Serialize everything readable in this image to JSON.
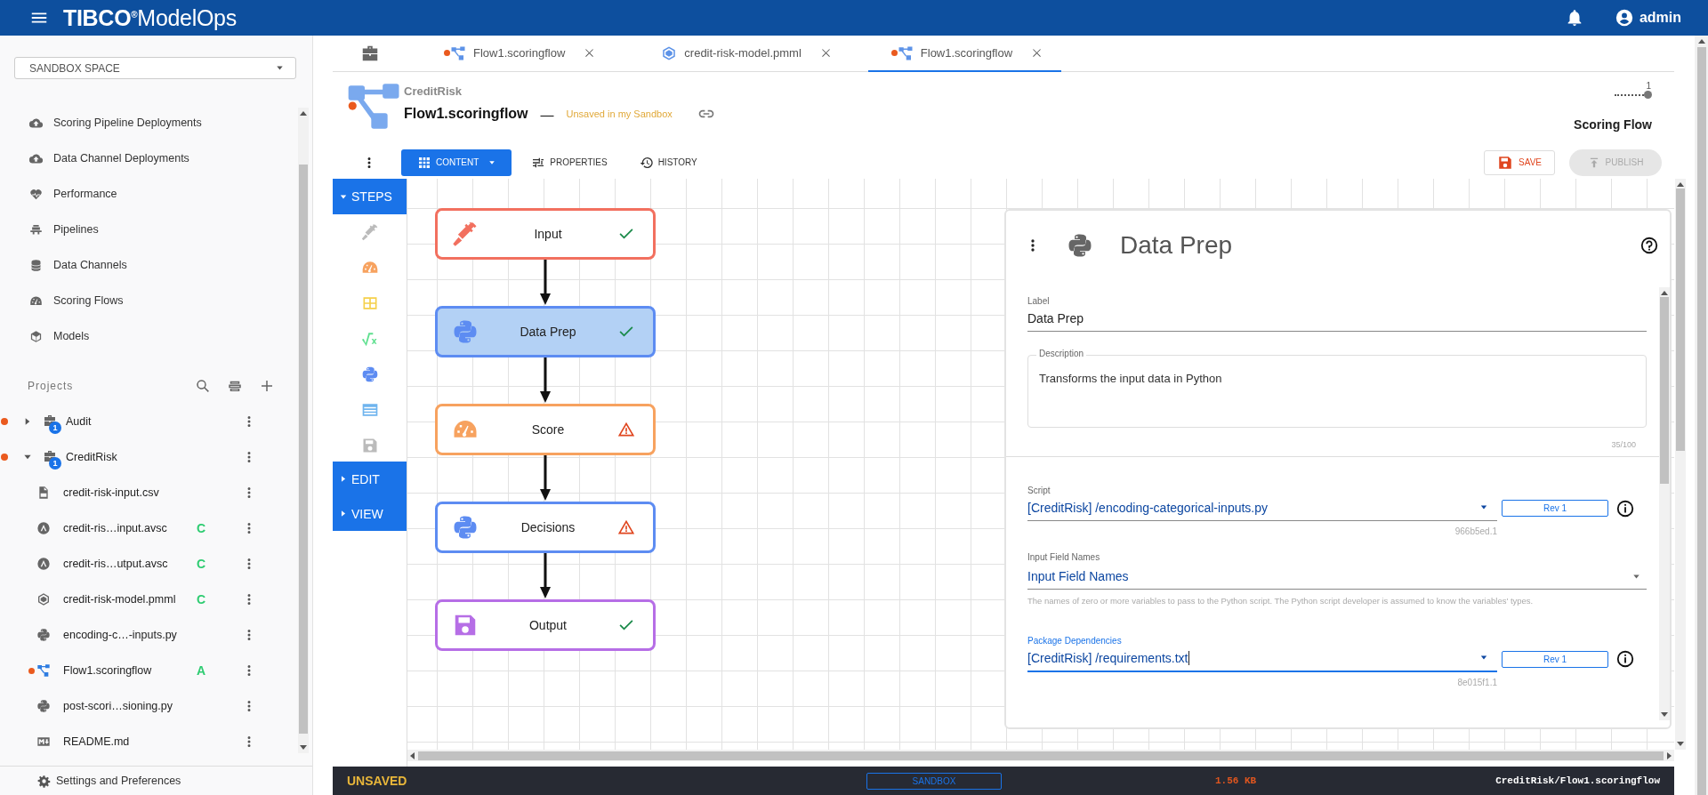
{
  "header": {
    "logo": {
      "brand": "TIBCO$^{®}$",
      "product": "ModelOps"
    },
    "user": "admin"
  },
  "sidebar": {
    "space": "SANDBOX SPACE",
    "nav": [
      {
        "label": "Scoring Pipeline Deployments",
        "kind": "cloud"
      },
      {
        "label": "Data Channel Deployments",
        "kind": "cloud"
      },
      {
        "label": "Performance",
        "kind": "heart"
      },
      {
        "label": "Pipelines",
        "kind": "pipeline"
      },
      {
        "label": "Data Channels",
        "kind": "database"
      },
      {
        "label": "Scoring Flows",
        "kind": "gauge"
      },
      {
        "label": "Models",
        "kind": "cube"
      }
    ],
    "projects_title": "Projects",
    "projects": [
      {
        "name": "Audit",
        "badge": "1",
        "unsaved": true,
        "expanded": false
      },
      {
        "name": "CreditRisk",
        "badge": "1",
        "unsaved": true,
        "expanded": true,
        "children": [
          {
            "name": "credit-risk-input.csv",
            "kind": "csv",
            "unsaved": false
          },
          {
            "name": "credit-ris…input.avsc",
            "kind": "avro",
            "status": "C",
            "unsaved": false
          },
          {
            "name": "credit-ris…utput.avsc",
            "kind": "avro",
            "status": "C",
            "unsaved": false
          },
          {
            "name": "credit-risk-model.pmml",
            "kind": "pmml",
            "status": "C",
            "unsaved": false
          },
          {
            "name": "encoding-c…-inputs.py",
            "kind": "python",
            "unsaved": false
          },
          {
            "name": "Flow1.scoringflow",
            "kind": "flow",
            "status": "A",
            "unsaved": true
          },
          {
            "name": "post-scori…sioning.py",
            "kind": "python",
            "unsaved": false
          },
          {
            "name": "README.md",
            "kind": "markdown",
            "unsaved": false
          }
        ]
      }
    ],
    "settings": "Settings and Preferences"
  },
  "tabs": [
    {
      "label": "Flow1.scoringflow",
      "kind": "flow",
      "unsaved": true,
      "selected": false
    },
    {
      "label": "credit-risk-model.pmml",
      "kind": "pmml",
      "unsaved": false,
      "selected": false
    },
    {
      "label": "Flow1.scoringflow",
      "kind": "flow",
      "unsaved": true,
      "selected": true
    }
  ],
  "document": {
    "project": "CreditRisk",
    "name": "Flow1.scoringflow",
    "separator": "—",
    "status": "Unsaved in my Sandbox",
    "unsaved": true,
    "version": "1",
    "type": "Scoring Flow"
  },
  "toolbar": {
    "views": [
      {
        "label": "CONTENT",
        "selected": true
      },
      {
        "label": "PROPERTIES",
        "selected": false
      },
      {
        "label": "HISTORY",
        "selected": false
      }
    ],
    "save": "SAVE",
    "publish": {
      "label": "PUBLISH",
      "disabled": true
    }
  },
  "palette": {
    "sections": [
      {
        "label": "STEPS",
        "expanded": true
      },
      {
        "label": "EDIT",
        "expanded": false
      },
      {
        "label": "VIEW",
        "expanded": false
      }
    ],
    "items": [
      {
        "kind": "input",
        "disabled": true
      },
      {
        "kind": "gauge",
        "disabled": false
      },
      {
        "kind": "table",
        "disabled": false
      },
      {
        "kind": "sqrt",
        "disabled": false
      },
      {
        "kind": "python",
        "disabled": false
      },
      {
        "kind": "list",
        "disabled": false
      },
      {
        "kind": "save",
        "disabled": true
      }
    ]
  },
  "flow": {
    "nodes": [
      {
        "label": "Input",
        "kind": "input",
        "color": "#f2705f",
        "valid": true,
        "selected": false
      },
      {
        "label": "Data Prep",
        "kind": "python",
        "color": "#5d8cf2",
        "valid": true,
        "selected": true
      },
      {
        "label": "Score",
        "kind": "gauge",
        "color": "#f7a25f",
        "valid": false,
        "selected": false
      },
      {
        "label": "Decisions",
        "kind": "python",
        "color": "#5d8cf2",
        "valid": false,
        "selected": false
      },
      {
        "label": "Output",
        "kind": "save",
        "color": "#b66ee6",
        "valid": true,
        "selected": false
      }
    ]
  },
  "panel": {
    "title": "Data Prep",
    "label_field": {
      "label": "Label",
      "value": "Data Prep"
    },
    "description": {
      "label": "Description",
      "value": "Transforms the input data in Python",
      "counter": "35/100"
    },
    "script": {
      "label": "Script",
      "value": "[CreditRisk] /encoding-categorical-inputs.py",
      "revision": "Rev 1",
      "hash": "966b5ed.1",
      "focused": false
    },
    "input_fields": {
      "label": "Input Field Names",
      "placeholder": "Input Field Names",
      "hint": "The names of zero or more variables to pass to the Python script. The Python script developer is assumed to know the variables' types."
    },
    "packages": {
      "label": "Package Dependencies",
      "value": "[CreditRisk] /requirements.txt",
      "revision": "Rev 1",
      "hash": "8e015f1.1",
      "focused": true
    }
  },
  "status_bar": {
    "state": "UNSAVED",
    "space": "SANDBOX",
    "size": "1.56 KB",
    "path": "CreditRisk/Flow1.scoringflow"
  }
}
